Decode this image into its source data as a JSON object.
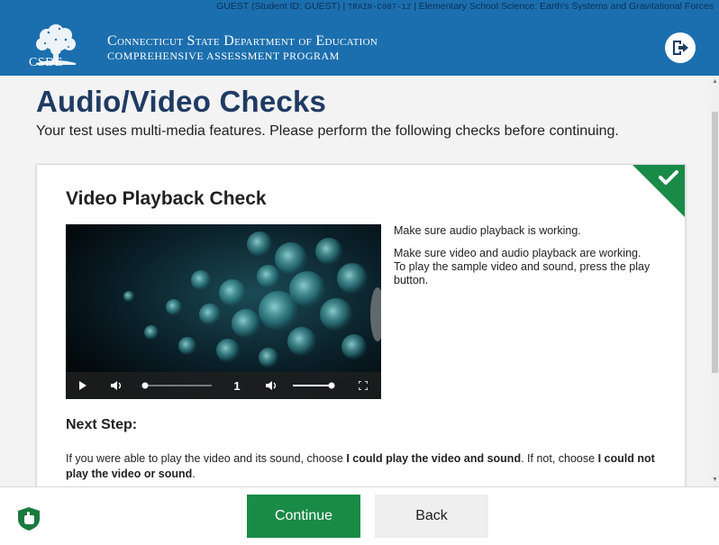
{
  "header": {
    "session_prefix": "GUEST (Student ID: GUEST) |",
    "session_code": "TRAIN-C087-12",
    "session_suffix": "| Elementary School Science: Earth's Systems and Gravitational Forces",
    "org_name": "Connecticut State Department of Education",
    "org_sub": "COMPREHENSIVE ASSESSMENT PROGRAM",
    "logo_text": "CSDE",
    "exit_icon": "exit-arrow-icon",
    "brand_color": "#1c6fae"
  },
  "main": {
    "title": "Audio/Video Checks",
    "subtitle": "Your test uses multi-media features. Please perform the following checks before continuing.",
    "card": {
      "title": "Video Playback Check",
      "status": "check-passed",
      "status_color": "#1a8a47",
      "desc1": "Make sure audio playback is working.",
      "desc2": "Make sure video and audio playback are working. To play the sample video and sound, press the play button.",
      "video": {
        "playback_rate": "1",
        "progress": 0.0,
        "volume": 1.0
      },
      "next_step_heading": "Next Step:",
      "next_text_1": "If you were able to play the video and its sound, choose ",
      "next_bold_1": "I could play the video and sound",
      "next_text_2": ". If not, choose ",
      "next_bold_2": "I could not play the video or sound",
      "next_text_3": "."
    }
  },
  "footer": {
    "help_icon": "help-hand-icon",
    "continue_label": "Continue",
    "back_label": "Back"
  }
}
